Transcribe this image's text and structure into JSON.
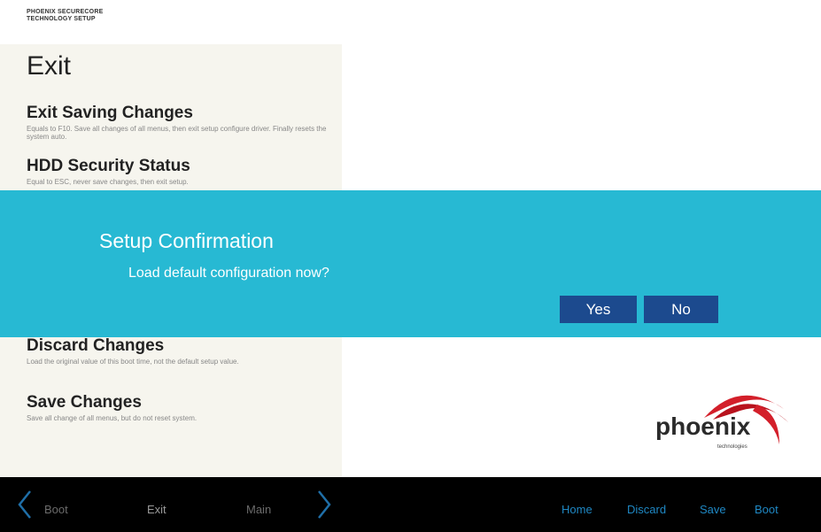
{
  "brand": {
    "line1": "PHOENIX SECURECORE",
    "line2": "TECHNOLOGY SETUP"
  },
  "panel": {
    "title": "Exit",
    "items": [
      {
        "label": "Exit Saving Changes",
        "desc": "Equals to F10. Save all changes of all menus, then exit setup configure driver. Finally resets the system auto."
      },
      {
        "label": "HDD Security Status",
        "desc": "Equal to ESC, never save changes, then exit setup."
      },
      {
        "label": "Discard Changes",
        "desc": "Load the original value of this boot time, not the default setup value."
      },
      {
        "label": "Save Changes",
        "desc": "Save all change of all menus, but do not reset system."
      }
    ]
  },
  "modal": {
    "title": "Setup Confirmation",
    "message": "Load default configuration now?",
    "yes_label": "Yes",
    "no_label": "No"
  },
  "logo": {
    "text": "phoenix",
    "sub": "technologies"
  },
  "bottom_bar": {
    "nav": [
      "Boot",
      "Exit",
      "Main"
    ],
    "actions": [
      "Home",
      "Discard",
      "Save",
      "Boot"
    ]
  },
  "colors": {
    "modal_bg": "#27b9d3",
    "button_bg": "#1c4a8e",
    "panel_bg": "#f6f5ee",
    "action_text": "#1f88c4",
    "logo_swoosh": "#d31f2a"
  },
  "icons": {
    "left_nav": "chevron-left-icon",
    "right_nav": "chevron-right-icon"
  }
}
